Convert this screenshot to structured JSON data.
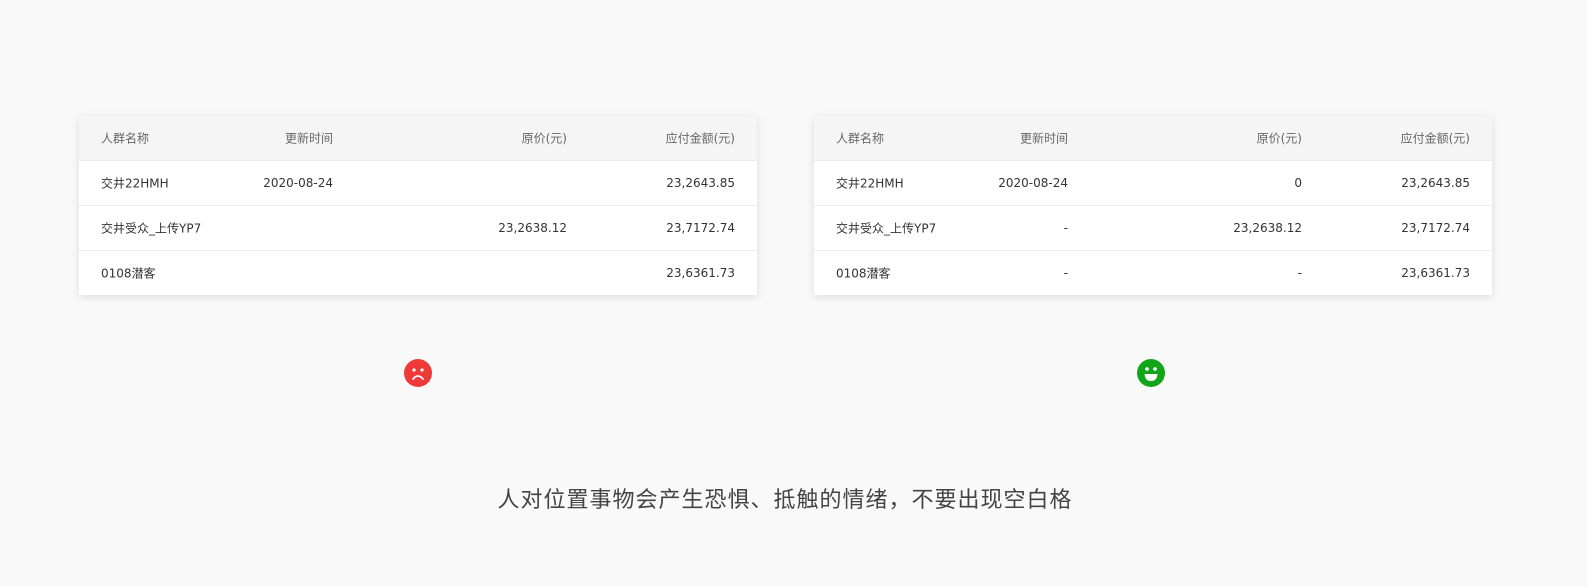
{
  "headers": [
    "人群名称",
    "更新时间",
    "原价(元)",
    "应付金额(元)"
  ],
  "bad_table": {
    "rows": [
      [
        "交井22HMH",
        "2020-08-24",
        "",
        "23,2643.85"
      ],
      [
        "交井受众_上传YP7",
        "",
        "23,2638.12",
        "23,7172.74"
      ],
      [
        "0108潜客",
        "",
        "",
        "23,6361.73"
      ]
    ]
  },
  "good_table": {
    "rows": [
      [
        "交井22HMH",
        "2020-08-24",
        "0",
        "23,2643.85"
      ],
      [
        "交井受众_上传YP7",
        "-",
        "23,2638.12",
        "23,7172.74"
      ],
      [
        "0108潜客",
        "-",
        "-",
        "23,6361.73"
      ]
    ]
  },
  "icons": {
    "bad": "sad-face-icon",
    "good": "happy-face-icon"
  },
  "colors": {
    "bad": "#f03a3a",
    "good": "#12a51a"
  },
  "caption": "人对位置事物会产生恐惧、抵触的情绪，不要出现空白格"
}
